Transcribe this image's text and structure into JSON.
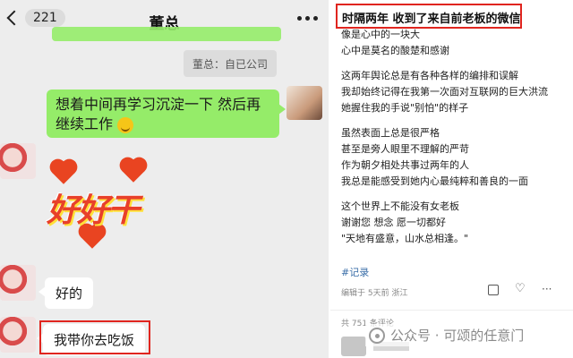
{
  "chat": {
    "back_count": "221",
    "title": "董总",
    "quote_text": "董总：自已公司",
    "message_out": "想着中间再学习沉淀一下 然后再继续工作",
    "sticker_text": "好好干",
    "reply_1": "好的",
    "reply_2": "我带你去吃饭"
  },
  "post": {
    "title": "时隔两年 收到了来自前老板的微信",
    "lines": [
      "像是心中的一块大",
      "心中是莫名的酸楚和感谢",
      "",
      "这两年舆论总是有各种各样的编排和误解",
      "我却始终记得在我第一次面对互联网的巨大洪流",
      "她握住我的手说\"别怕\"的样子",
      "",
      "虽然表面上总是很严格",
      "甚至是旁人眼里不理解的严苛",
      "作为朝夕相处共事过两年的人",
      "我总是能感受到她内心最纯粹和善良的一面",
      "",
      "这个世界上不能没有女老板",
      "谢谢您 想念 愿一切都好",
      "\"天地有盛意，山水总相逢。\""
    ],
    "tag": "#记录",
    "meta": "编辑于 5天前 浙江",
    "comments": "共 751 条评论"
  },
  "watermark": "公众号 · 可颂的任意门"
}
